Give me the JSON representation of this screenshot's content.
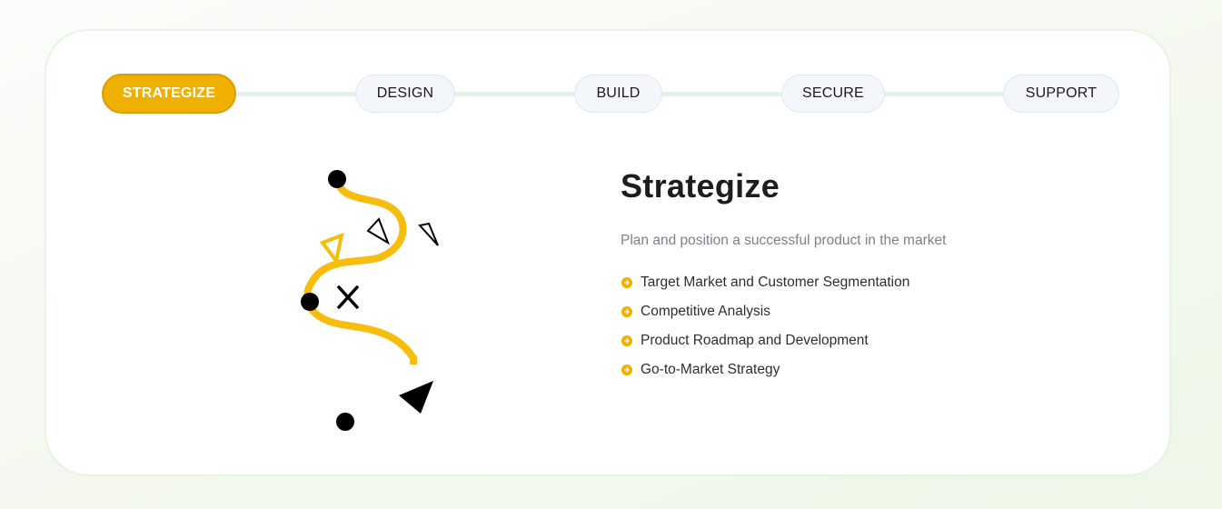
{
  "steps": [
    {
      "label": "STRATEGIZE",
      "active": true
    },
    {
      "label": "DESIGN",
      "active": false
    },
    {
      "label": "BUILD",
      "active": false
    },
    {
      "label": "SECURE",
      "active": false
    },
    {
      "label": "SUPPORT",
      "active": false
    }
  ],
  "panel": {
    "title": "Strategize",
    "subtitle": "Plan and position a successful product in the market",
    "bullets": [
      "Target Market and Customer Segmentation",
      "Competitive Analysis",
      "Product Roadmap and Development",
      "Go-to-Market Strategy"
    ]
  },
  "colors": {
    "accent": "#efb000",
    "illustration_path": "#f6bd0d",
    "illustration_marks": "#000000"
  },
  "icons": {
    "bullet": "arrow-right-circle-icon",
    "illustration": "winding-path-illustration"
  }
}
